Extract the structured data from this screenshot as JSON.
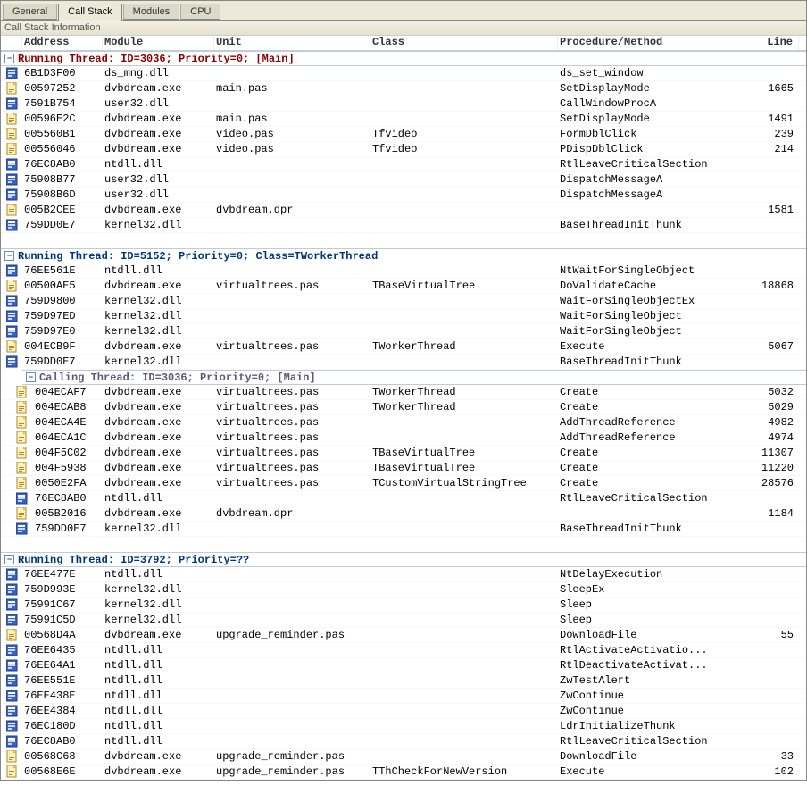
{
  "tabs": [
    "General",
    "Call Stack",
    "Modules",
    "CPU"
  ],
  "active_tab": 1,
  "infobar": "Call Stack Information",
  "columns": {
    "address": "Address",
    "module": "Module",
    "unit": "Unit",
    "class": "Class",
    "proc": "Procedure/Method",
    "line": "Line"
  },
  "groups": [
    {
      "type": "main",
      "title": "Running Thread: ID=3036; Priority=0;  [Main]",
      "rows": [
        {
          "ic": "b",
          "addr": "6B1D3F00",
          "mod": "ds_mng.dll",
          "unit": "",
          "class": "",
          "proc": "ds_set_window",
          "line": ""
        },
        {
          "ic": "y",
          "addr": "00597252",
          "mod": "dvbdream.exe",
          "unit": "main.pas",
          "class": "",
          "proc": "SetDisplayMode",
          "line": "1665"
        },
        {
          "ic": "b",
          "addr": "7591B754",
          "mod": "user32.dll",
          "unit": "",
          "class": "",
          "proc": "CallWindowProcA",
          "line": ""
        },
        {
          "ic": "y",
          "addr": "00596E2C",
          "mod": "dvbdream.exe",
          "unit": "main.pas",
          "class": "",
          "proc": "SetDisplayMode",
          "line": "1491"
        },
        {
          "ic": "y",
          "addr": "005560B1",
          "mod": "dvbdream.exe",
          "unit": "video.pas",
          "class": "Tfvideo",
          "proc": "FormDblClick",
          "line": "239"
        },
        {
          "ic": "y",
          "addr": "00556046",
          "mod": "dvbdream.exe",
          "unit": "video.pas",
          "class": "Tfvideo",
          "proc": "PDispDblClick",
          "line": "214"
        },
        {
          "ic": "b",
          "addr": "76EC8AB0",
          "mod": "ntdll.dll",
          "unit": "",
          "class": "",
          "proc": "RtlLeaveCriticalSection",
          "line": ""
        },
        {
          "ic": "b",
          "addr": "75908B77",
          "mod": "user32.dll",
          "unit": "",
          "class": "",
          "proc": "DispatchMessageA",
          "line": ""
        },
        {
          "ic": "b",
          "addr": "75908B6D",
          "mod": "user32.dll",
          "unit": "",
          "class": "",
          "proc": "DispatchMessageA",
          "line": ""
        },
        {
          "ic": "y",
          "addr": "005B2CEE",
          "mod": "dvbdream.exe",
          "unit": "dvbdream.dpr",
          "class": "",
          "proc": "",
          "line": "1581"
        },
        {
          "ic": "b",
          "addr": "759DD0E7",
          "mod": "kernel32.dll",
          "unit": "",
          "class": "",
          "proc": "BaseThreadInitThunk",
          "line": ""
        }
      ]
    },
    {
      "type": "sub",
      "title": "Running Thread: ID=5152; Priority=0; Class=TWorkerThread",
      "rows": [
        {
          "ic": "b",
          "addr": "76EE561E",
          "mod": "ntdll.dll",
          "unit": "",
          "class": "",
          "proc": "NtWaitForSingleObject",
          "line": ""
        },
        {
          "ic": "y",
          "addr": "00500AE5",
          "mod": "dvbdream.exe",
          "unit": "virtualtrees.pas",
          "class": "TBaseVirtualTree",
          "proc": "DoValidateCache",
          "line": "18868"
        },
        {
          "ic": "b",
          "addr": "759D9800",
          "mod": "kernel32.dll",
          "unit": "",
          "class": "",
          "proc": "WaitForSingleObjectEx",
          "line": ""
        },
        {
          "ic": "b",
          "addr": "759D97ED",
          "mod": "kernel32.dll",
          "unit": "",
          "class": "",
          "proc": "WaitForSingleObject",
          "line": ""
        },
        {
          "ic": "b",
          "addr": "759D97E0",
          "mod": "kernel32.dll",
          "unit": "",
          "class": "",
          "proc": "WaitForSingleObject",
          "line": ""
        },
        {
          "ic": "y",
          "addr": "004ECB9F",
          "mod": "dvbdream.exe",
          "unit": "virtualtrees.pas",
          "class": "TWorkerThread",
          "proc": "Execute",
          "line": "5067"
        },
        {
          "ic": "b",
          "addr": "759DD0E7",
          "mod": "kernel32.dll",
          "unit": "",
          "class": "",
          "proc": "BaseThreadInitThunk",
          "line": ""
        }
      ],
      "nested": {
        "title": "Calling Thread: ID=3036; Priority=0;  [Main]",
        "rows": [
          {
            "ic": "y",
            "addr": "004ECAF7",
            "mod": "dvbdream.exe",
            "unit": "virtualtrees.pas",
            "class": "TWorkerThread",
            "proc": "Create",
            "line": "5032"
          },
          {
            "ic": "y",
            "addr": "004ECAB8",
            "mod": "dvbdream.exe",
            "unit": "virtualtrees.pas",
            "class": "TWorkerThread",
            "proc": "Create",
            "line": "5029"
          },
          {
            "ic": "y",
            "addr": "004ECA4E",
            "mod": "dvbdream.exe",
            "unit": "virtualtrees.pas",
            "class": "",
            "proc": "AddThreadReference",
            "line": "4982"
          },
          {
            "ic": "y",
            "addr": "004ECA1C",
            "mod": "dvbdream.exe",
            "unit": "virtualtrees.pas",
            "class": "",
            "proc": "AddThreadReference",
            "line": "4974"
          },
          {
            "ic": "y",
            "addr": "004F5C02",
            "mod": "dvbdream.exe",
            "unit": "virtualtrees.pas",
            "class": "TBaseVirtualTree",
            "proc": "Create",
            "line": "11307"
          },
          {
            "ic": "y",
            "addr": "004F5938",
            "mod": "dvbdream.exe",
            "unit": "virtualtrees.pas",
            "class": "TBaseVirtualTree",
            "proc": "Create",
            "line": "11220"
          },
          {
            "ic": "y",
            "addr": "0050E2FA",
            "mod": "dvbdream.exe",
            "unit": "virtualtrees.pas",
            "class": "TCustomVirtualStringTree",
            "proc": "Create",
            "line": "28576"
          },
          {
            "ic": "b",
            "addr": "76EC8AB0",
            "mod": "ntdll.dll",
            "unit": "",
            "class": "",
            "proc": "RtlLeaveCriticalSection",
            "line": ""
          },
          {
            "ic": "y",
            "addr": "005B2016",
            "mod": "dvbdream.exe",
            "unit": "dvbdream.dpr",
            "class": "",
            "proc": "",
            "line": "1184"
          },
          {
            "ic": "b",
            "addr": "759DD0E7",
            "mod": "kernel32.dll",
            "unit": "",
            "class": "",
            "proc": "BaseThreadInitThunk",
            "line": ""
          }
        ]
      }
    },
    {
      "type": "sub",
      "title": "Running Thread: ID=3792; Priority=??",
      "rows": [
        {
          "ic": "b",
          "addr": "76EE477E",
          "mod": "ntdll.dll",
          "unit": "",
          "class": "",
          "proc": "NtDelayExecution",
          "line": ""
        },
        {
          "ic": "b",
          "addr": "759D993E",
          "mod": "kernel32.dll",
          "unit": "",
          "class": "",
          "proc": "SleepEx",
          "line": ""
        },
        {
          "ic": "b",
          "addr": "75991C67",
          "mod": "kernel32.dll",
          "unit": "",
          "class": "",
          "proc": "Sleep",
          "line": ""
        },
        {
          "ic": "b",
          "addr": "75991C5D",
          "mod": "kernel32.dll",
          "unit": "",
          "class": "",
          "proc": "Sleep",
          "line": ""
        },
        {
          "ic": "y",
          "addr": "00568D4A",
          "mod": "dvbdream.exe",
          "unit": "upgrade_reminder.pas",
          "class": "",
          "proc": "DownloadFile",
          "line": "55"
        },
        {
          "ic": "b",
          "addr": "76EE6435",
          "mod": "ntdll.dll",
          "unit": "",
          "class": "",
          "proc": "RtlActivateActivatio...",
          "line": ""
        },
        {
          "ic": "b",
          "addr": "76EE64A1",
          "mod": "ntdll.dll",
          "unit": "",
          "class": "",
          "proc": "RtlDeactivateActivat...",
          "line": ""
        },
        {
          "ic": "b",
          "addr": "76EE551E",
          "mod": "ntdll.dll",
          "unit": "",
          "class": "",
          "proc": "ZwTestAlert",
          "line": ""
        },
        {
          "ic": "b",
          "addr": "76EE438E",
          "mod": "ntdll.dll",
          "unit": "",
          "class": "",
          "proc": "ZwContinue",
          "line": ""
        },
        {
          "ic": "b",
          "addr": "76EE4384",
          "mod": "ntdll.dll",
          "unit": "",
          "class": "",
          "proc": "ZwContinue",
          "line": ""
        },
        {
          "ic": "b",
          "addr": "76EC180D",
          "mod": "ntdll.dll",
          "unit": "",
          "class": "",
          "proc": "LdrInitializeThunk",
          "line": ""
        },
        {
          "ic": "b",
          "addr": "76EC8AB0",
          "mod": "ntdll.dll",
          "unit": "",
          "class": "",
          "proc": "RtlLeaveCriticalSection",
          "line": ""
        },
        {
          "ic": "y",
          "addr": "00568C68",
          "mod": "dvbdream.exe",
          "unit": "upgrade_reminder.pas",
          "class": "",
          "proc": "DownloadFile",
          "line": "33"
        },
        {
          "ic": "y",
          "addr": "00568E6E",
          "mod": "dvbdream.exe",
          "unit": "upgrade_reminder.pas",
          "class": "TThCheckForNewVersion",
          "proc": "Execute",
          "line": "102"
        }
      ]
    }
  ]
}
